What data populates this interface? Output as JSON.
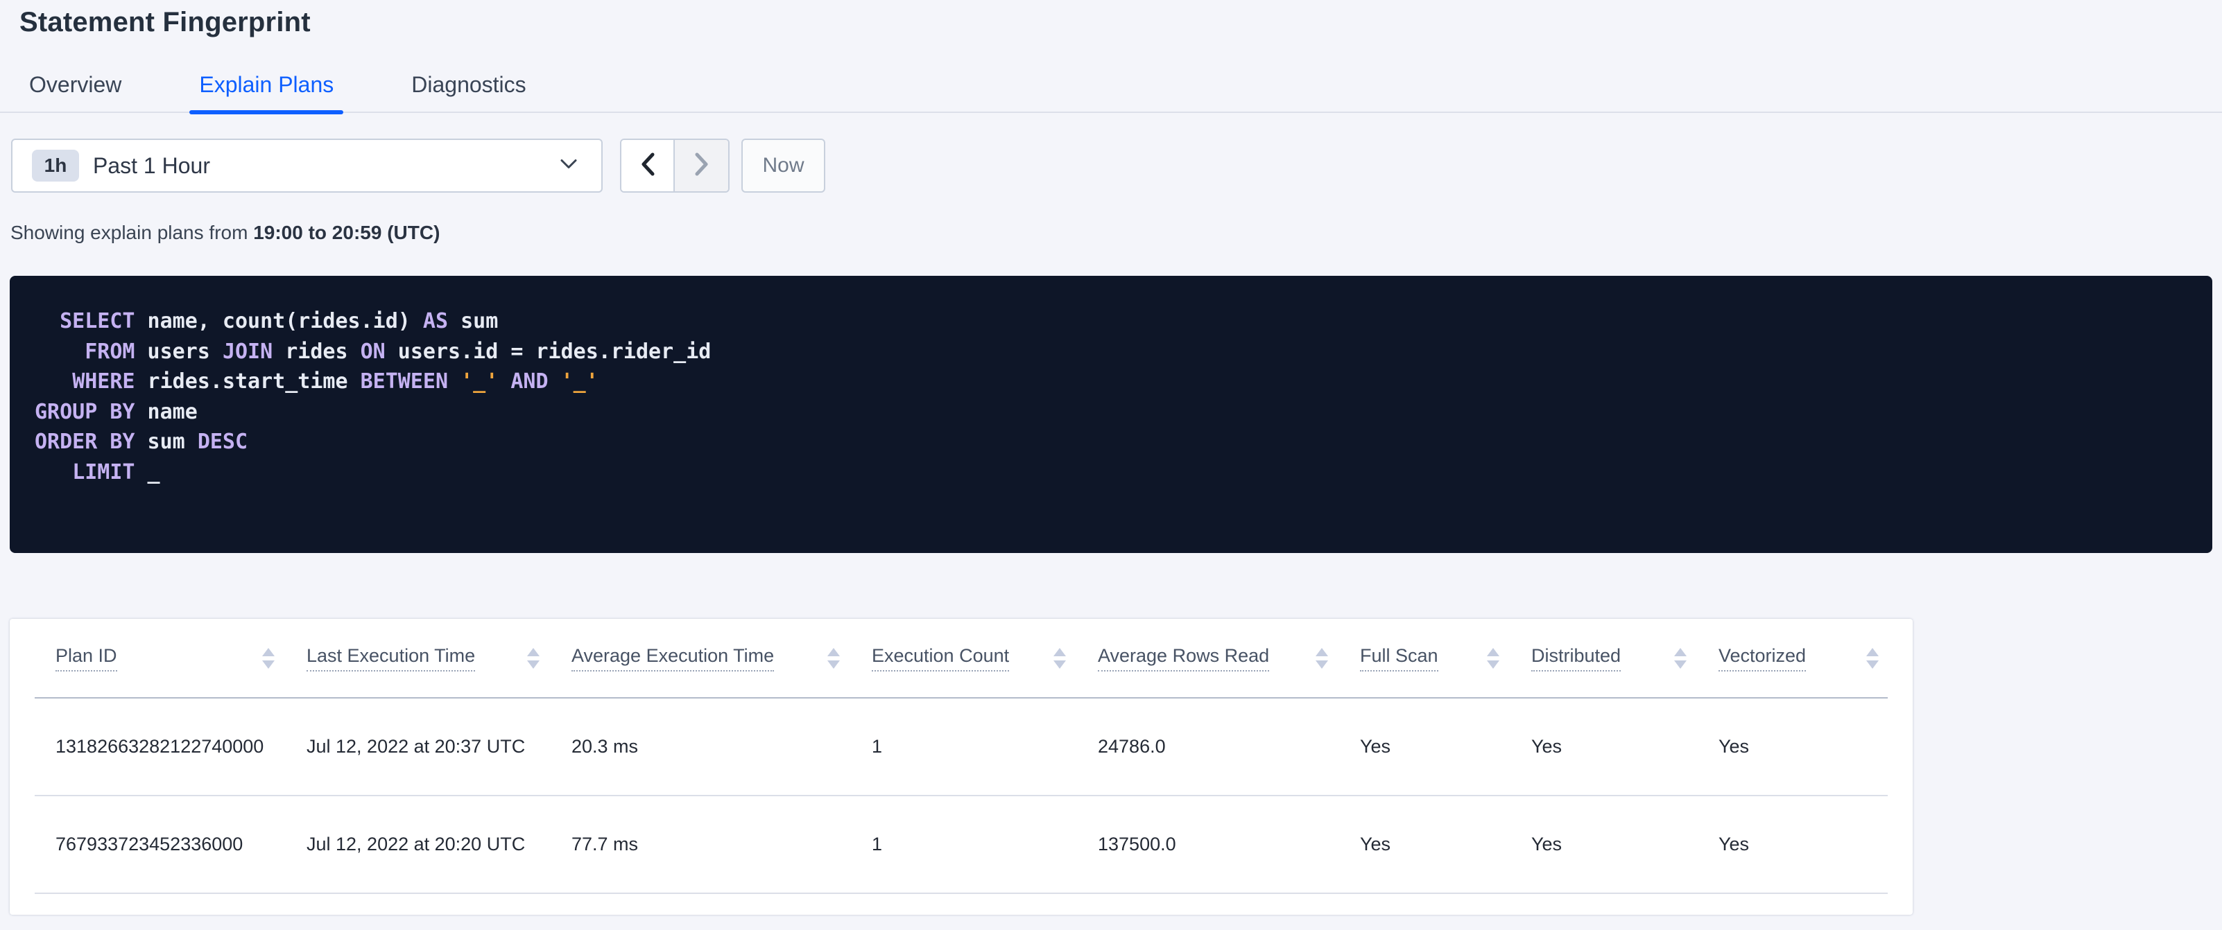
{
  "page": {
    "title": "Statement Fingerprint"
  },
  "tabs": [
    {
      "label": "Overview",
      "active": false
    },
    {
      "label": "Explain Plans",
      "active": true
    },
    {
      "label": "Diagnostics",
      "active": false
    }
  ],
  "time_picker": {
    "badge": "1h",
    "selected": "Past 1 Hour",
    "now_label": "Now"
  },
  "summary": {
    "prefix": "Showing explain plans from ",
    "range": "19:00 to 20:59 (UTC)"
  },
  "sql": {
    "lines": [
      [
        {
          "t": "id",
          "s": "  "
        },
        {
          "t": "kw",
          "s": "SELECT"
        },
        {
          "t": "id",
          "s": " name, count(rides.id) "
        },
        {
          "t": "kw",
          "s": "AS"
        },
        {
          "t": "id",
          "s": " sum"
        }
      ],
      [
        {
          "t": "id",
          "s": "    "
        },
        {
          "t": "kw",
          "s": "FROM"
        },
        {
          "t": "id",
          "s": " users "
        },
        {
          "t": "kw",
          "s": "JOIN"
        },
        {
          "t": "id",
          "s": " rides "
        },
        {
          "t": "kw",
          "s": "ON"
        },
        {
          "t": "id",
          "s": " users.id = rides.rider_id"
        }
      ],
      [
        {
          "t": "id",
          "s": "   "
        },
        {
          "t": "kw",
          "s": "WHERE"
        },
        {
          "t": "id",
          "s": " rides.start_time "
        },
        {
          "t": "kw",
          "s": "BETWEEN"
        },
        {
          "t": "id",
          "s": " "
        },
        {
          "t": "lit",
          "s": "'_'"
        },
        {
          "t": "id",
          "s": " "
        },
        {
          "t": "kw",
          "s": "AND"
        },
        {
          "t": "id",
          "s": " "
        },
        {
          "t": "lit",
          "s": "'_'"
        }
      ],
      [
        {
          "t": "kw",
          "s": "GROUP BY"
        },
        {
          "t": "id",
          "s": " name"
        }
      ],
      [
        {
          "t": "kw",
          "s": "ORDER BY"
        },
        {
          "t": "id",
          "s": " sum "
        },
        {
          "t": "kw",
          "s": "DESC"
        }
      ],
      [
        {
          "t": "id",
          "s": "   "
        },
        {
          "t": "kw",
          "s": "LIMIT"
        },
        {
          "t": "id",
          "s": " _"
        }
      ]
    ]
  },
  "table": {
    "columns": [
      {
        "label": "Plan ID"
      },
      {
        "label": "Last Execution Time"
      },
      {
        "label": "Average Execution Time"
      },
      {
        "label": "Execution Count"
      },
      {
        "label": "Average Rows Read"
      },
      {
        "label": "Full Scan"
      },
      {
        "label": "Distributed"
      },
      {
        "label": "Vectorized"
      }
    ],
    "rows": [
      [
        "13182663282122740000",
        "Jul 12, 2022 at 20:37 UTC",
        "20.3 ms",
        "1",
        "24786.0",
        "Yes",
        "Yes",
        "Yes"
      ],
      [
        "767933723452336000",
        "Jul 12, 2022 at 20:20 UTC",
        "77.7 ms",
        "1",
        "137500.0",
        "Yes",
        "Yes",
        "Yes"
      ]
    ]
  },
  "colors": {
    "accent_blue": "#0E5FFF",
    "sql_background": "#0E1628",
    "sql_keyword": "#C5B2F2",
    "sql_identifier": "#E7EBF3",
    "sql_literal": "#EFA53D"
  }
}
